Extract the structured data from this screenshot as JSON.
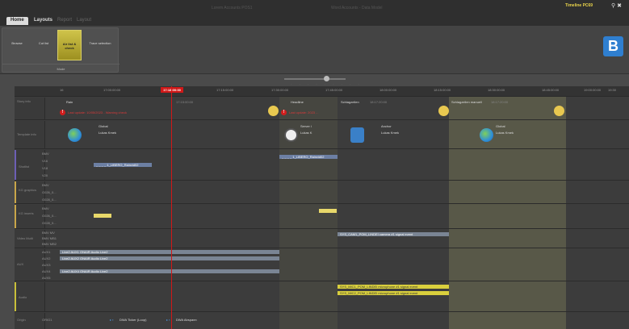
{
  "titlebar": {
    "faint_left": "Lorem Accounts POS1",
    "faint_right": "Word Accounts - Data Model",
    "timeline_title": "Timeline PC69",
    "win_icons": "⚲ ✖"
  },
  "ribbon": {
    "tabs": [
      {
        "label": "Home",
        "active": true
      },
      {
        "label": "Layouts",
        "active": false
      },
      {
        "label": "Report",
        "active": false
      },
      {
        "label": "Layout",
        "active": false
      }
    ],
    "mode_buttons": [
      {
        "label": "Browse"
      },
      {
        "label": "Cut list"
      },
      {
        "label": "Air list & check",
        "selected": true
      },
      {
        "label": "Trace selection"
      }
    ],
    "mode_group_label": "Mode",
    "logo": "B"
  },
  "zoom": {
    "ticks": "- - - - - - - - -",
    "value": 0.65
  },
  "timeline": {
    "ruler_ticks": [
      "16",
      "17:00:00:00",
      "17:15:00:00",
      "17:30:00:00",
      "17:45:00:00",
      "18:00:00:00",
      "18:15:00:00",
      "18:30:00:00",
      "18:45:00:00",
      "19:00:00:00",
      "19:15:00:00",
      "19:30"
    ],
    "current_time": "17:18:00:00",
    "rows": {
      "story_info": "Story info",
      "template_info": "Template info",
      "shotlist": "Shotlist",
      "kg_graphics": "KG graphics",
      "kg_inserts": "KG inserts",
      "video_multi": "Video Multi",
      "audio_aux": "AUX",
      "audio": "Audio",
      "origin": "Origin"
    },
    "story": [
      {
        "title": "Rain",
        "time": "17:15:00:00",
        "warn": "Last update: 10/05/2023 - Warning check",
        "avatar": true
      },
      {
        "title": "Headline",
        "time": "",
        "warn": "Last update: 2023 ...",
        "avatar": false
      },
      {
        "title": "Schlagzeilen",
        "time": "18:17:20:00",
        "warn": "",
        "avatar": true
      },
      {
        "title": "Schlagzeilen manuell",
        "time": "18:17:20:00",
        "warn": "",
        "avatar": true
      }
    ],
    "templates": [
      {
        "line1": "Global",
        "line2": "Lukas Kmek"
      },
      {
        "line1": "Server i",
        "line2": "Lukas K"
      },
      {
        "line1": "Anchor",
        "line2": "Lukas Kmek"
      },
      {
        "line1": "Global",
        "line2": "Lukas Kmek"
      }
    ],
    "shotlist_sub": [
      "BMV",
      "V16",
      "V18",
      "V20"
    ],
    "shotlist_bars": [
      "_ _ _ _ 1_LIBERO_Rainvid02",
      "_ _ _ _ 1_LIBERO_Rainvid02"
    ],
    "kg_graphics_sub": [
      "BMV",
      "G026_0...",
      "G028_0..."
    ],
    "kg_inserts_sub": [
      "BMV",
      "G026_0...",
      "G028_0..."
    ],
    "video_multi_sub": [
      "BMV MV",
      "BMV MB1",
      "BMV MB2"
    ],
    "video_multi_bar": "SYS_CAM1_POM_LINDEI  camera #1 signal event",
    "aux_sub": [
      "AUX1",
      "AUX2",
      "AUX3",
      "AUX4",
      "AUX5"
    ],
    "aux_bars": [
      "Live2 AUX1 ONAIR  Audio Live2",
      "Live2 AUX2 ONAIR  Audio Live2",
      "Live2 AUX4 ONAIR  Audio Live2"
    ],
    "audio_bars": [
      "SYS_MIC1_POM_LINDEI  microphone #1 signal event",
      "SYS_MIC2_POM_LINDEI  microphone #1 signal event"
    ],
    "origin_sub": "ORIG1",
    "origin_items": [
      "DWA Ticker (Loop)",
      "DWA Abspann"
    ]
  }
}
